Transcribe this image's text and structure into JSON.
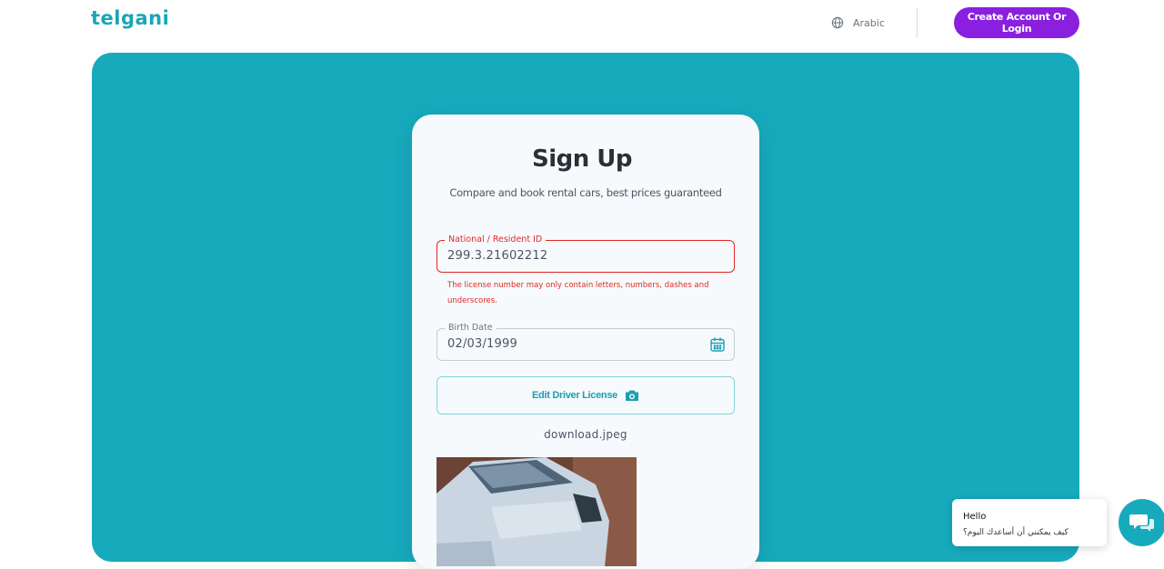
{
  "header": {
    "logo_text": "telgani",
    "language_label": "Arabic",
    "language_icon": "globe-icon",
    "cta_label": "Create Account Or Login"
  },
  "signup": {
    "title": "Sign Up",
    "subtitle": "Compare and book rental cars, best prices guaranteed",
    "national_id": {
      "label": "National / Resident ID",
      "value": "299.3.21602212",
      "error": "The license number may only contain letters, numbers, dashes and underscores."
    },
    "birth_date": {
      "label": "Birth Date",
      "value": "02/03/1999",
      "icon": "calendar-icon"
    },
    "license_button": {
      "label": "Edit Driver License",
      "icon": "camera-icon"
    },
    "filename": "download.jpeg"
  },
  "chat": {
    "greeting": "Hello",
    "message": "كيف يمكنني أن أساعدك اليوم؟",
    "icon": "chat-icon"
  },
  "colors": {
    "brand": "#17aabd",
    "cta": "#8a1fe0",
    "error": "#e02828"
  }
}
